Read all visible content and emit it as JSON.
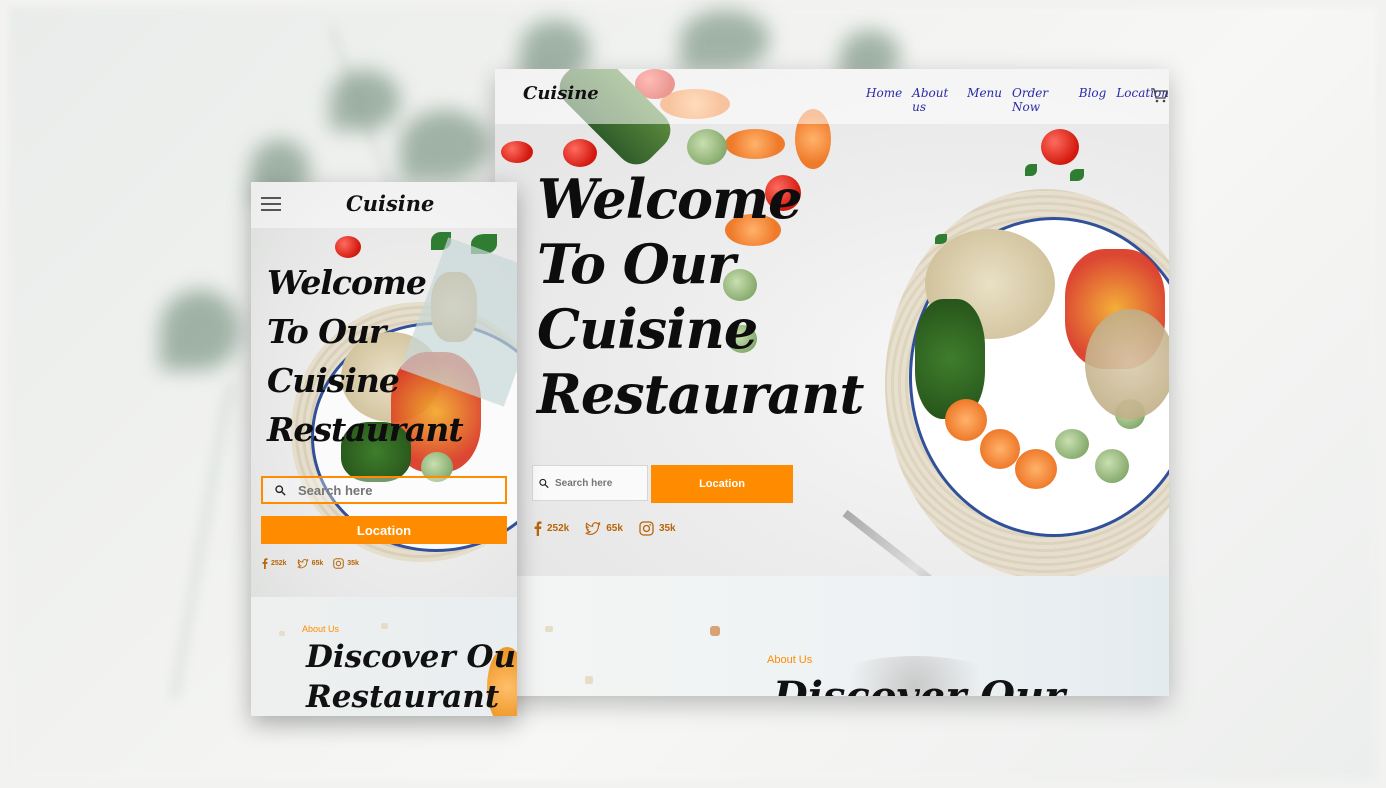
{
  "desktop": {
    "logo": "Cuisine",
    "nav": [
      "Home",
      "About us",
      "Menu",
      "Order Now",
      "Blog",
      "Location"
    ],
    "hero_title": [
      "Welcome",
      "To Our",
      "Cuisine",
      "Restaurant"
    ],
    "search_placeholder": "Search here",
    "location_button": "Location",
    "social": {
      "facebook": "252k",
      "twitter": "65k",
      "instagram": "35k"
    },
    "about_label": "About Us",
    "about_title": "Discover Our"
  },
  "mobile": {
    "logo": "Cuisine",
    "hero_title": [
      "Welcome",
      "To Our",
      "Cuisine",
      "Restaurant"
    ],
    "search_placeholder": "Search here",
    "location_button": "Location",
    "social": {
      "facebook": "252k",
      "twitter": "65k",
      "instagram": "35k"
    },
    "about_label": "About Us",
    "about_title": [
      "Discover Our",
      "Restaurant"
    ]
  },
  "colors": {
    "accent": "#ff8c00",
    "nav_link": "#2a2aa8",
    "social": "#b8650a"
  },
  "icons": [
    "menu-icon",
    "cart-icon",
    "search-icon",
    "facebook-icon",
    "twitter-icon",
    "instagram-icon"
  ]
}
